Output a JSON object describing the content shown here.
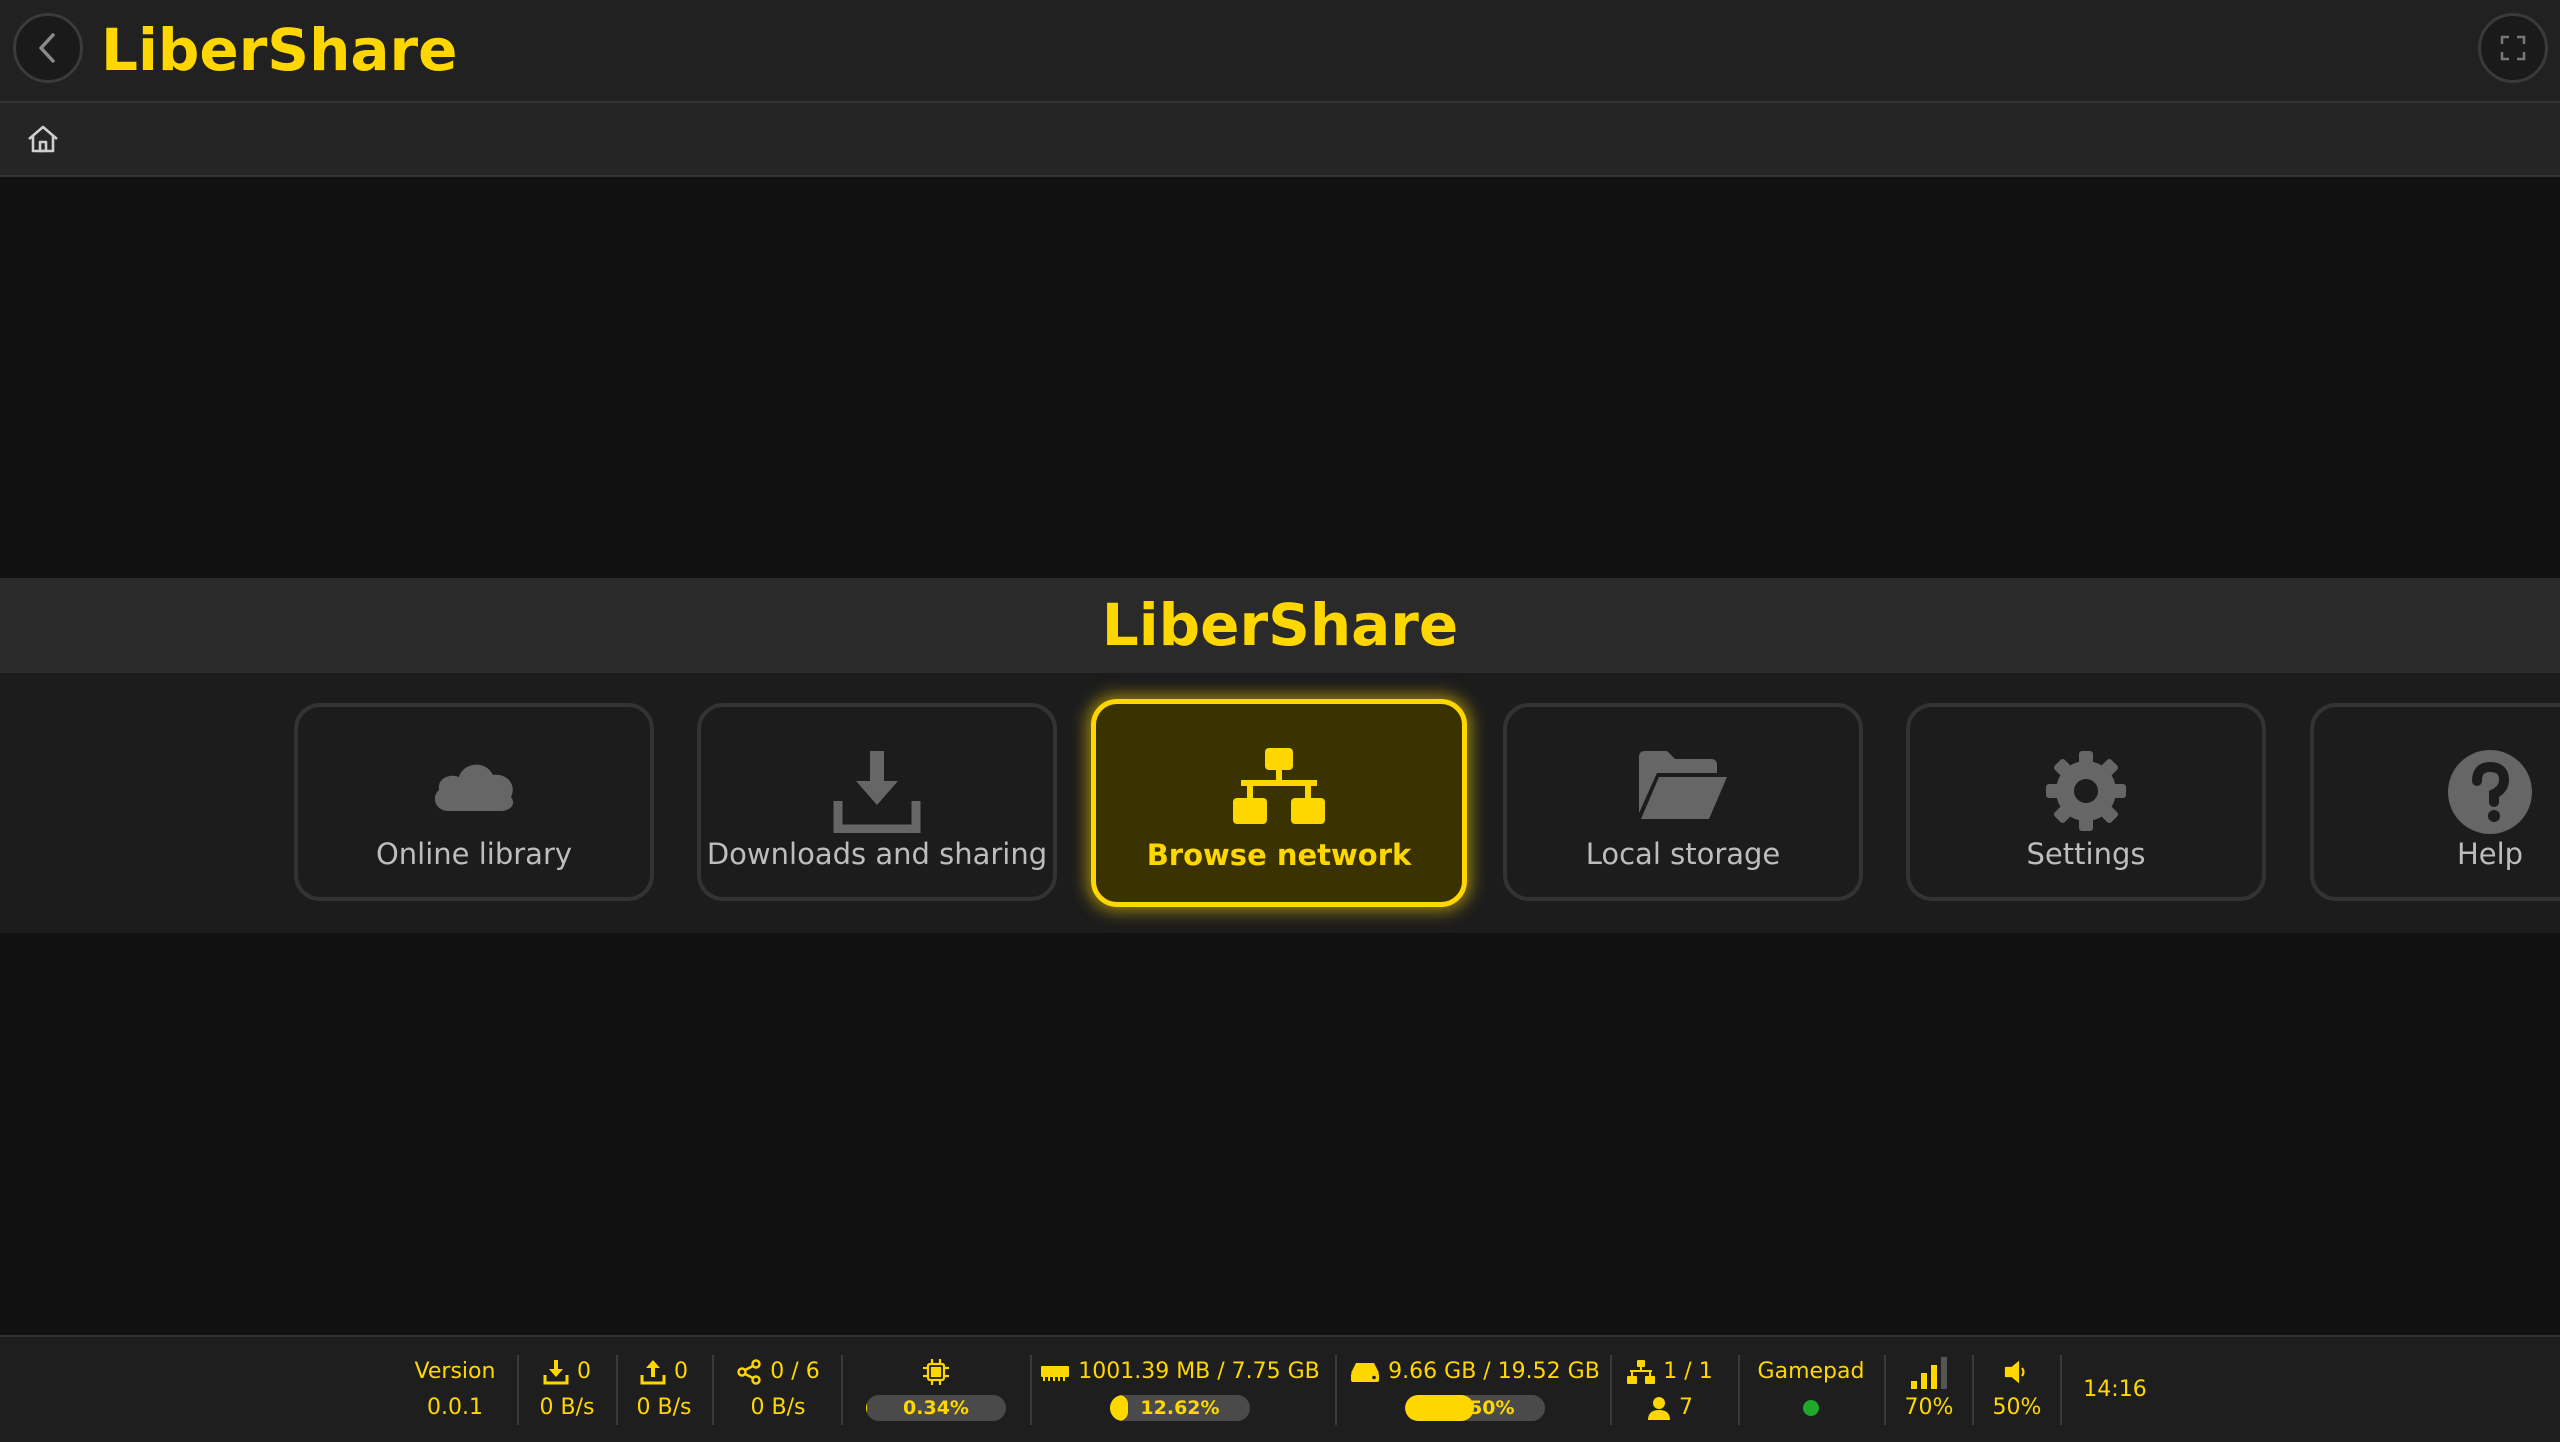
{
  "app": {
    "title": "LiberShare"
  },
  "header": {
    "back_icon": "chevron-left-icon",
    "fullscreen_icon": "fullscreen-icon"
  },
  "breadcrumb": {
    "home_icon": "home-icon"
  },
  "section": {
    "title": "LiberShare"
  },
  "menu": {
    "items": [
      {
        "label": "Online library",
        "icon": "cloud-icon"
      },
      {
        "label": "Downloads and sharing",
        "icon": "download-icon"
      },
      {
        "label": "Browse network",
        "icon": "network-icon",
        "selected": true
      },
      {
        "label": "Local storage",
        "icon": "folder-open-icon"
      },
      {
        "label": "Settings",
        "icon": "gear-icon"
      },
      {
        "label": "Help",
        "icon": "question-icon"
      }
    ]
  },
  "status": {
    "version_label": "Version",
    "version_value": "0.0.1",
    "download_count": "0",
    "download_speed": "0 B/s",
    "upload_count": "0",
    "upload_speed": "0 B/s",
    "share_count": "0 / 6",
    "share_speed": "0 B/s",
    "cpu_percent": "0.34%",
    "cpu_fraction": 0.0034,
    "ram_text": "1001.39 MB / 7.75 GB",
    "ram_percent": "12.62%",
    "ram_fraction": 0.1262,
    "disk_text": "9.66 GB / 19.52 GB",
    "disk_percent": "49.50%",
    "disk_fraction": 0.495,
    "network_count": "1 / 1",
    "users_count": "7",
    "gamepad_label": "Gamepad",
    "gamepad_status_color": "#1fa82a",
    "signal_percent": "70%",
    "volume_percent": "50%",
    "clock": "14:16"
  },
  "colors": {
    "accent": "#ffd700",
    "background": "#111111",
    "panel": "#212121"
  }
}
